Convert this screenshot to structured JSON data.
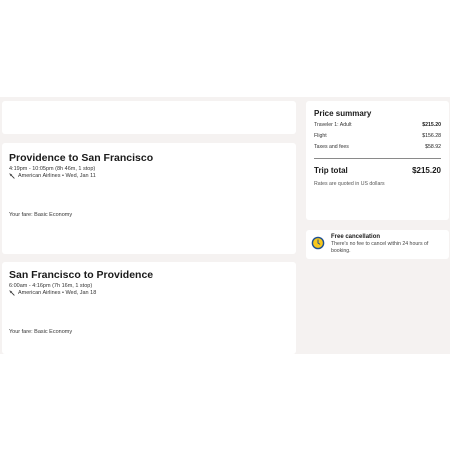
{
  "flights": [
    {
      "title": "Providence to San Francisco",
      "times": "4:19pm - 10:05pm (8h 46m, 1 stop)",
      "airline": "American Airlines • Wed, Jan 11",
      "fare": "Your fare: Basic Economy"
    },
    {
      "title": "San Francisco to Providence",
      "times": "6:00am - 4:16pm (7h 16m, 1 stop)",
      "airline": "American Airlines • Wed, Jan 18",
      "fare": "Your fare: Basic Economy"
    }
  ],
  "price_summary": {
    "title": "Price summary",
    "rows": [
      {
        "label": "Traveler 1: Adult",
        "value": "$215.20"
      },
      {
        "label": "Flight",
        "value": "$156.28"
      },
      {
        "label": "Taxes and fees",
        "value": "$58.92"
      }
    ],
    "total_label": "Trip total",
    "total_value": "$215.20",
    "note": "Rates are quoted in US dollars"
  },
  "cancellation": {
    "title": "Free cancellation",
    "text": "There's no fee to cancel within 24 hours of booking."
  },
  "icons": {
    "airline": "airplane-icon",
    "cancellation": "clock-icon"
  },
  "colors": {
    "page_band": "#f5f2f1",
    "clock_blue": "#1c4f91",
    "clock_yellow": "#f8c81c"
  }
}
